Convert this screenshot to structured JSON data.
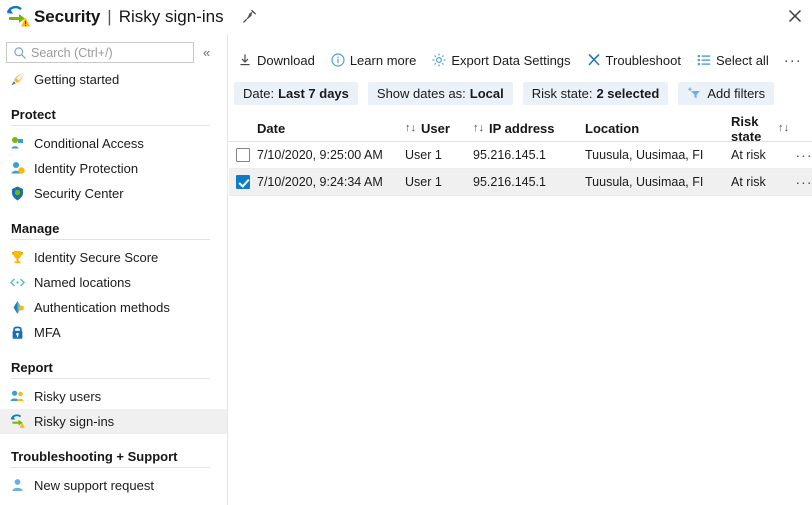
{
  "titlebar": {
    "brand_icon": "security-risky-signins-icon",
    "title": "Security",
    "separator": "|",
    "subtitle": "Risky sign-ins",
    "pin_icon": "pin-icon",
    "close_icon": "close-icon"
  },
  "sidebar": {
    "search": {
      "placeholder": "Search (Ctrl+/)",
      "value": "",
      "icon": "search-icon"
    },
    "collapse_icon": "«",
    "top_items": [
      {
        "label": "Getting started",
        "icon": "rocket-icon",
        "selected": false
      }
    ],
    "sections": [
      {
        "title": "Protect",
        "items": [
          {
            "label": "Conditional Access",
            "icon": "conditional-access-icon",
            "selected": false
          },
          {
            "label": "Identity Protection",
            "icon": "identity-protection-icon",
            "selected": false
          },
          {
            "label": "Security Center",
            "icon": "shield-icon",
            "selected": false
          }
        ]
      },
      {
        "title": "Manage",
        "items": [
          {
            "label": "Identity Secure Score",
            "icon": "trophy-icon",
            "selected": false
          },
          {
            "label": "Named locations",
            "icon": "code-brackets-icon",
            "selected": false
          },
          {
            "label": "Authentication methods",
            "icon": "authentication-methods-icon",
            "selected": false
          },
          {
            "label": "MFA",
            "icon": "lock-icon",
            "selected": false
          }
        ]
      },
      {
        "title": "Report",
        "items": [
          {
            "label": "Risky users",
            "icon": "risky-users-icon",
            "selected": false
          },
          {
            "label": "Risky sign-ins",
            "icon": "risky-signins-icon",
            "selected": true
          }
        ]
      },
      {
        "title": "Troubleshooting + Support",
        "items": [
          {
            "label": "New support request",
            "icon": "support-person-icon",
            "selected": false
          }
        ]
      }
    ]
  },
  "toolbar": {
    "buttons": [
      {
        "label": "Download",
        "icon": "download-icon"
      },
      {
        "label": "Learn more",
        "icon": "info-icon"
      },
      {
        "label": "Export Data Settings",
        "icon": "gear-icon"
      },
      {
        "label": "Troubleshoot",
        "icon": "wrench-icon"
      },
      {
        "label": "Select all",
        "icon": "select-all-icon"
      }
    ],
    "more_label": "···"
  },
  "filters": [
    {
      "name": "Date:",
      "value": "Last 7 days",
      "icon": ""
    },
    {
      "name": "Show dates as:",
      "value": "Local",
      "icon": ""
    },
    {
      "name": "Risk state:",
      "value": "2 selected",
      "icon": ""
    },
    {
      "name": "Add filters",
      "value": "",
      "icon": "add-filter-icon"
    }
  ],
  "table": {
    "columns": [
      {
        "label": "Date",
        "sort_before": "",
        "sort_after": ""
      },
      {
        "label": "User",
        "sort_before": "↑↓",
        "sort_after": ""
      },
      {
        "label": "IP address",
        "sort_before": "↑↓",
        "sort_after": ""
      },
      {
        "label": "Location",
        "sort_before": "",
        "sort_after": ""
      },
      {
        "label": "Risk state",
        "sort_before": "",
        "sort_after": "↑↓"
      }
    ],
    "rows": [
      {
        "checked": false,
        "date": "7/10/2020, 9:25:00 AM",
        "user": "User 1",
        "ip": "95.216.145.1",
        "location": "Tuusula, Uusimaa, FI",
        "risk_state": "At risk",
        "more": "···"
      },
      {
        "checked": true,
        "date": "7/10/2020, 9:24:34 AM",
        "user": "User 1",
        "ip": "95.216.145.1",
        "location": "Tuusula, Uusimaa, FI",
        "risk_state": "At risk",
        "more": "···"
      }
    ]
  },
  "colors": {
    "accent_blue": "#0f7ac8",
    "icon_blue": "#4a9fd8",
    "pill_bg": "#eaf1f8",
    "selected_row": "#f0f0f0",
    "green": "#7ab800",
    "yellow": "#ffb900"
  }
}
